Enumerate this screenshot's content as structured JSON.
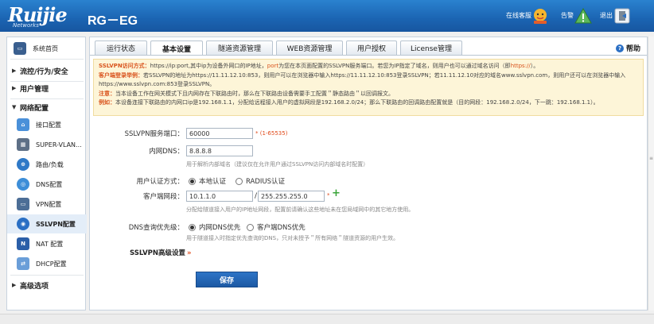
{
  "header": {
    "logo": "Ruijie",
    "logo_sub": "Networks",
    "product": "RG－EG",
    "online_customer": "在线客服",
    "alert": "告警",
    "logout": "退出"
  },
  "sidebar": {
    "home": "系统首页",
    "groups": [
      {
        "label": "流控/行为/安全",
        "arrow": "▶"
      },
      {
        "label": "用户管理",
        "arrow": "▶"
      },
      {
        "label": "网络配置",
        "arrow": "▼"
      },
      {
        "label": "高级选项",
        "arrow": "▶"
      }
    ],
    "network_items": [
      "接口配置",
      "SUPER-VLAN...",
      "路由/负载",
      "DNS配置",
      "VPN配置",
      "SSLVPN配置",
      "NAT 配置",
      "DHCP配置"
    ]
  },
  "tabs": [
    "运行状态",
    "基本设置",
    "隧道资源管理",
    "WEB资源管理",
    "用户授权",
    "License管理"
  ],
  "active_tab": "基本设置",
  "help": "帮助",
  "info": {
    "line1_label": "SSLVPN访问方式：",
    "line1_text": "https://ip:port,其中ip为设备外网口的IP地址，",
    "line1_port": "port",
    "line1_text2": "为您在本页面配置的SSLVPN服务端口。若您为IP指定了域名，则用户也可以通过域名访问（即",
    "line1_https": "https://",
    "line1_end": "）。",
    "line2_label": "客户端登录举例：",
    "line2_text": "若SSLVPN的地址为https://11.11.12.10:853，则用户可以在浏览器中输入https://11.11.12.10:853登录SSLVPN；若11.11.12.10对应的域名www.sslvpn.com，则用户还可以在浏览器中输入",
    "line3_text": "https://www.sslvpn.com:853登录SSLVPN。",
    "line4_label": "注意：",
    "line4_text": "当本设备工作在网关模式下且内网存在下联路由时，那么在下联路由设备需要手工配置＂静态路由＂以回调报文。",
    "line5_label": "例如：",
    "line5_text": "本设备连接下联路由的内网口ip是192.168.1.1，分配给远程接入用户的虚拟网段是192.168.2.0/24；那么下联路由的回调路由配置就是（目的网段：192.168.2.0/24，下一跳：192.168.1.1）。"
  },
  "form": {
    "port_label": "SSLVPN服务端口：",
    "port_value": "60000",
    "port_hint": "* (1-65535)",
    "dns_label": "内网DNS：",
    "dns_value": "8.8.8.8",
    "dns_hint": "用于解析内部域名（建议仅在允许用户通过SSLVPN访问内部域名时配置）",
    "auth_label": "用户认证方式：",
    "auth_local": "本地认证",
    "auth_radius": "RADIUS认证",
    "segment_label": "客户端网段：",
    "segment_ip": "10.1.1.0",
    "segment_sep": "/",
    "segment_mask": "255.255.255.0",
    "segment_star": "*",
    "segment_hint": "分配给隧道接入用户的IP地址网段，配置前请确认这些地址未在您局域网中的其它地方使用。",
    "dns_pref_label": "DNS查询优先级：",
    "dns_pref_internal": "内网DNS优先",
    "dns_pref_client": "客户端DNS优先",
    "dns_pref_hint": "用于隧道接入时指定优先查询的DNS，只对未授予＂所有网络＂隧道资源的用户生效。",
    "advanced": "SSLVPN高级设置",
    "advanced_chevron": "»",
    "save": "保存"
  }
}
